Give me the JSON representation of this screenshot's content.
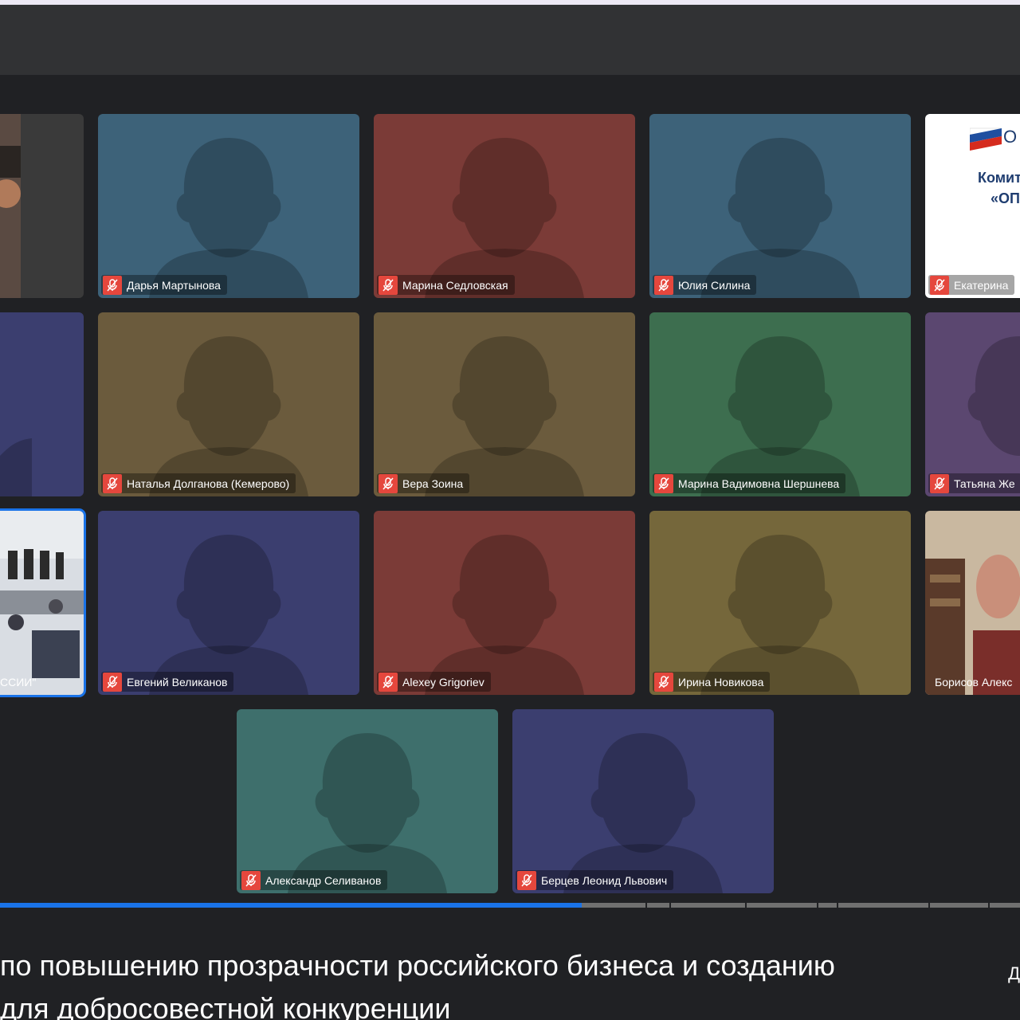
{
  "colors": {
    "teal_blue": "#3d6279",
    "brick": "#7b3b37",
    "navy": "#3b3e6f",
    "olive_brown": "#6b5b3d",
    "green": "#3d6e4f",
    "purple": "#5b4770",
    "teal": "#3e6f6c",
    "mustard": "#75673b",
    "mic_red": "#e5473d",
    "accent_blue": "#1a73e8"
  },
  "participants": [
    {
      "name": "Дарья Мартынова"
    },
    {
      "name": "Марина Седловская"
    },
    {
      "name": "Юлия Силина"
    },
    {
      "name": "Екатерина"
    },
    {
      "name": "Наталья Долганова (Кемерово)"
    },
    {
      "name": "Вера Зоина"
    },
    {
      "name": "Марина Вадимовна Шершнева"
    },
    {
      "name": "Татьяна Же"
    },
    {
      "name": "Евгений Великанов"
    },
    {
      "name": "Alexey Grigoriev"
    },
    {
      "name": "Ирина Новикова"
    },
    {
      "name": "Борисов Алекс"
    },
    {
      "name": "Александр Селиванов"
    },
    {
      "name": "Берцев Леонид Львович"
    },
    {
      "name": "ССИИ\""
    }
  ],
  "slide": {
    "logo_text": "О",
    "line1": "Комит",
    "line2": "«ОП"
  },
  "player": {
    "progress": 0.57
  },
  "caption": {
    "line1": "по повышению прозрачности российского бизнеса и созданию",
    "line2": "для добросовестной конкуренции",
    "right_mark": "Д"
  }
}
